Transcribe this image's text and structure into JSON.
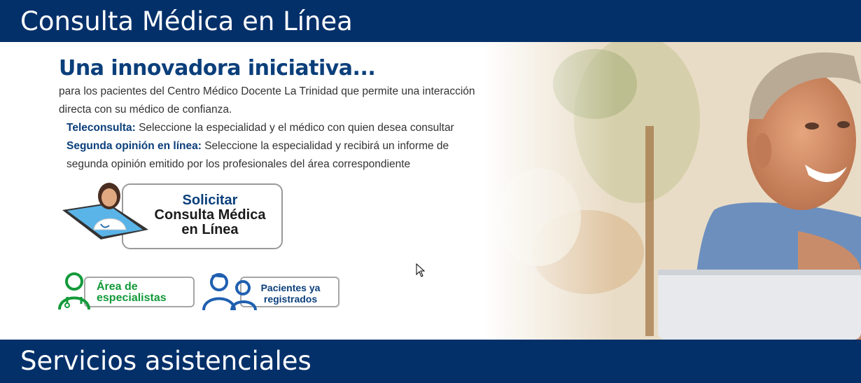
{
  "header": {
    "title": "Consulta Médica en Línea"
  },
  "intro": {
    "headline": "Una innovadora iniciativa...",
    "paragraph": "para los pacientes del Centro Médico Docente La Trinidad que permite una interacción directa con su médico de confianza.",
    "teleconsulta_label": "Teleconsulta:",
    "teleconsulta_text": "Seleccione la especialidad y el médico con quien desea consultar",
    "segunda_label": "Segunda opinión en línea:",
    "segunda_text": "Seleccione la especialidad y recibirá un informe de segunda opinión emitido por los profesionales del área correspondiente"
  },
  "cta": {
    "line1": "Solicitar",
    "line2": "Consulta Médica",
    "line3": "en Línea"
  },
  "buttons": {
    "especialistas_line1": "Área de",
    "especialistas_line2": "especialistas",
    "registrados_line1": "Pacientes ya",
    "registrados_line2": "registrados"
  },
  "footer": {
    "title": "Servicios asistenciales"
  },
  "colors": {
    "navy": "#04306a",
    "heading_blue": "#0b3f7b",
    "green": "#139a3a"
  },
  "icons": [
    "doctor-tablet-icon",
    "specialist-icon",
    "patients-icon",
    "mouse-cursor-icon"
  ]
}
